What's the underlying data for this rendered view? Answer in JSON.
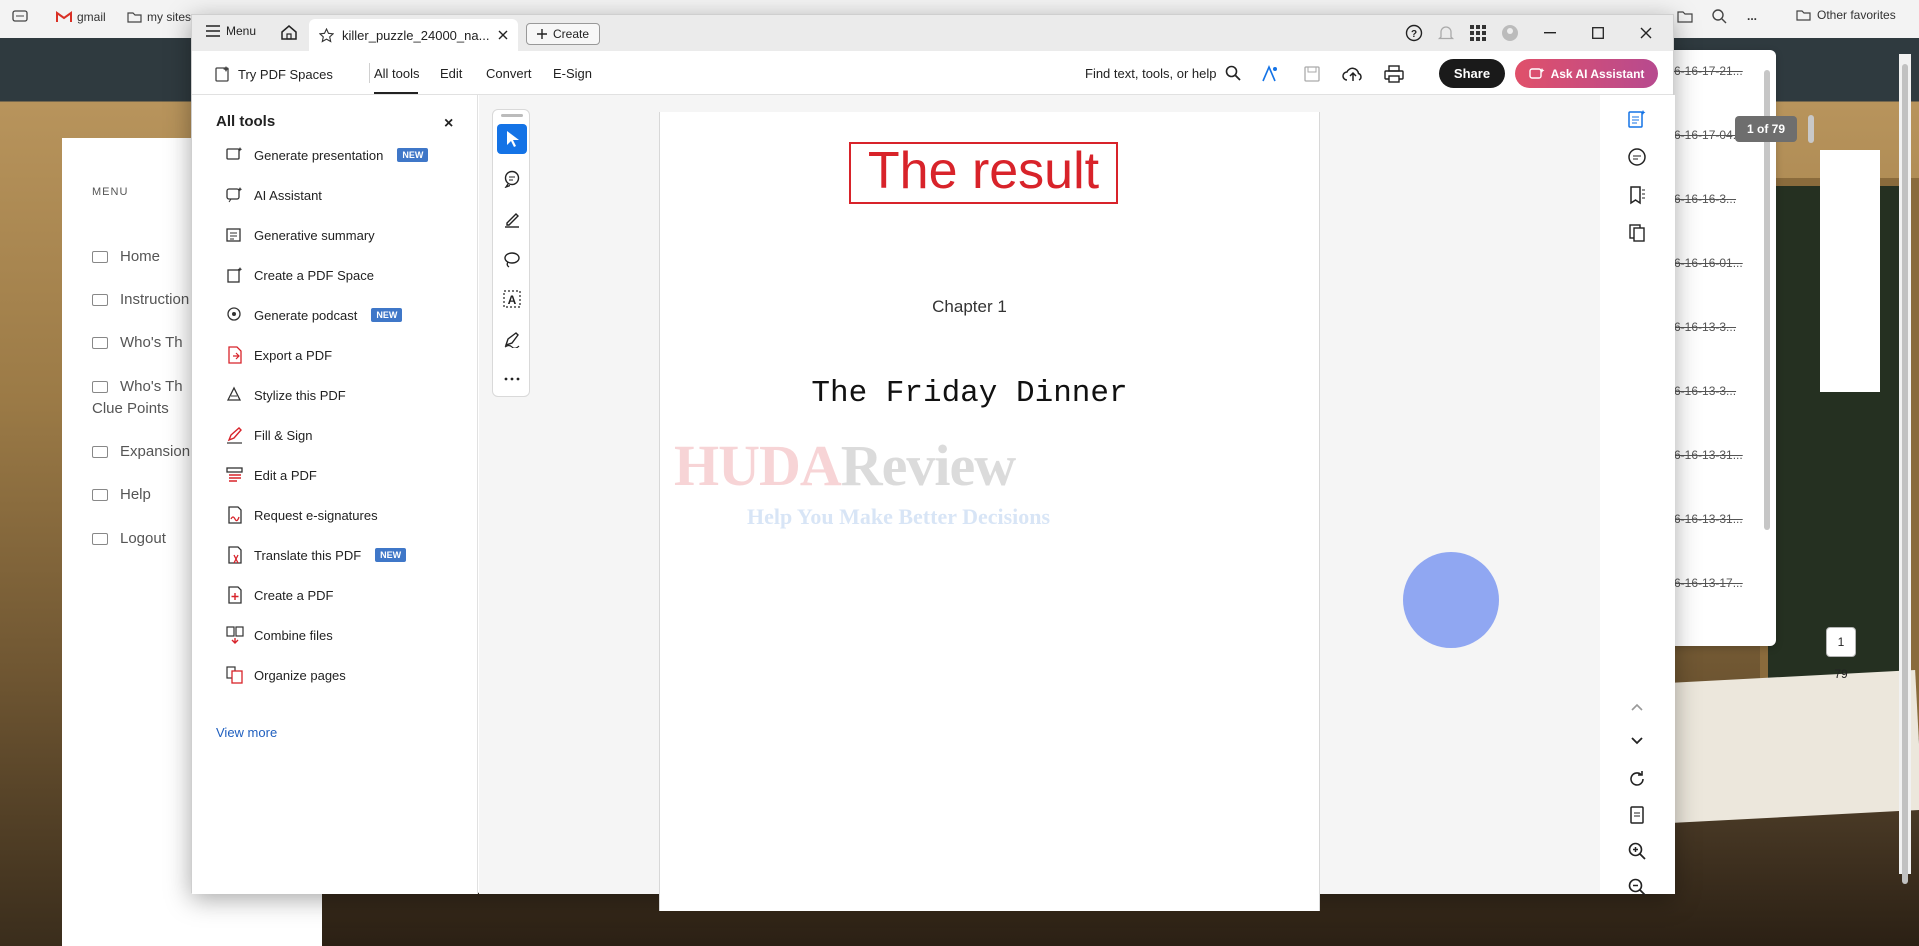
{
  "browser": {
    "bookmarks": [
      {
        "label": "gmail",
        "icon": "gmail-icon"
      },
      {
        "label": "my sites",
        "icon": "folder-icon"
      }
    ],
    "other_favorites": "Other favorites",
    "more": "..."
  },
  "site": {
    "menu_title": "MENU",
    "items": [
      {
        "label": "Home"
      },
      {
        "label": "Instruction"
      },
      {
        "label": "Who's Th"
      },
      {
        "label": "Who's Th"
      },
      {
        "label": "Clue Points"
      },
      {
        "label": "Expansion"
      },
      {
        "label": "Help"
      },
      {
        "label": "Logout"
      }
    ]
  },
  "downloads": {
    "items": [
      "6-16-17-21...",
      "6-16-17-04...",
      "6-16-16-3...",
      "6-16-16-01...",
      "6-16-13-3...",
      "6-16-13-3...",
      "6-16-13-31...",
      "6-16-13-31...",
      "6-16-13-17..."
    ]
  },
  "window": {
    "menu_label": "Menu",
    "tab_title": "killer_puzzle_24000_na...",
    "create_label": "Create"
  },
  "toolbar": {
    "try_spaces": "Try PDF Spaces",
    "tabs": [
      "All tools",
      "Edit",
      "Convert",
      "E-Sign"
    ],
    "find_placeholder": "Find text, tools, or help",
    "share_label": "Share",
    "ai_label": "Ask AI Assistant"
  },
  "tools_panel": {
    "heading": "All tools",
    "close": "×",
    "items": [
      {
        "label": "Generate presentation",
        "badge": "NEW",
        "icon": "presentation-icon",
        "color": "#333"
      },
      {
        "label": "AI Assistant",
        "badge": "",
        "icon": "ai-assistant-icon",
        "color": "#333"
      },
      {
        "label": "Generative summary",
        "badge": "",
        "icon": "summary-icon",
        "color": "#333"
      },
      {
        "label": "Create a PDF Space",
        "badge": "",
        "icon": "pdf-space-icon",
        "color": "#333"
      },
      {
        "label": "Generate podcast",
        "badge": "NEW",
        "icon": "podcast-icon",
        "color": "#333"
      },
      {
        "label": "Export a PDF",
        "badge": "",
        "icon": "export-pdf-icon",
        "color": "#d8232a"
      },
      {
        "label": "Stylize this PDF",
        "badge": "",
        "icon": "stylize-icon",
        "color": "#333"
      },
      {
        "label": "Fill & Sign",
        "badge": "",
        "icon": "fill-sign-icon",
        "color": "#d8232a"
      },
      {
        "label": "Edit a PDF",
        "badge": "",
        "icon": "edit-pdf-icon",
        "color": "#d8232a"
      },
      {
        "label": "Request e-signatures",
        "badge": "",
        "icon": "e-signature-icon",
        "color": "#d8232a"
      },
      {
        "label": "Translate this PDF",
        "badge": "NEW",
        "icon": "translate-icon",
        "color": "#d8232a"
      },
      {
        "label": "Create a PDF",
        "badge": "",
        "icon": "create-pdf-icon",
        "color": "#d8232a"
      },
      {
        "label": "Combine files",
        "badge": "",
        "icon": "combine-icon",
        "color": "#d8232a"
      },
      {
        "label": "Organize pages",
        "badge": "",
        "icon": "organize-icon",
        "color": "#d8232a"
      }
    ],
    "view_more": "View more"
  },
  "document": {
    "result_text": "The result",
    "chapter": "Chapter 1",
    "title": "The Friday Dinner",
    "watermark_a": "HUDA",
    "watermark_b": "Review",
    "watermark_sub": "Help You Make Better Decisions"
  },
  "pager": {
    "badge": "1 of 79",
    "current": "1",
    "total": "79"
  },
  "colors": {
    "accent": "#1473e6",
    "brand_red": "#d8232a",
    "share_bg": "#1a1a1a"
  }
}
